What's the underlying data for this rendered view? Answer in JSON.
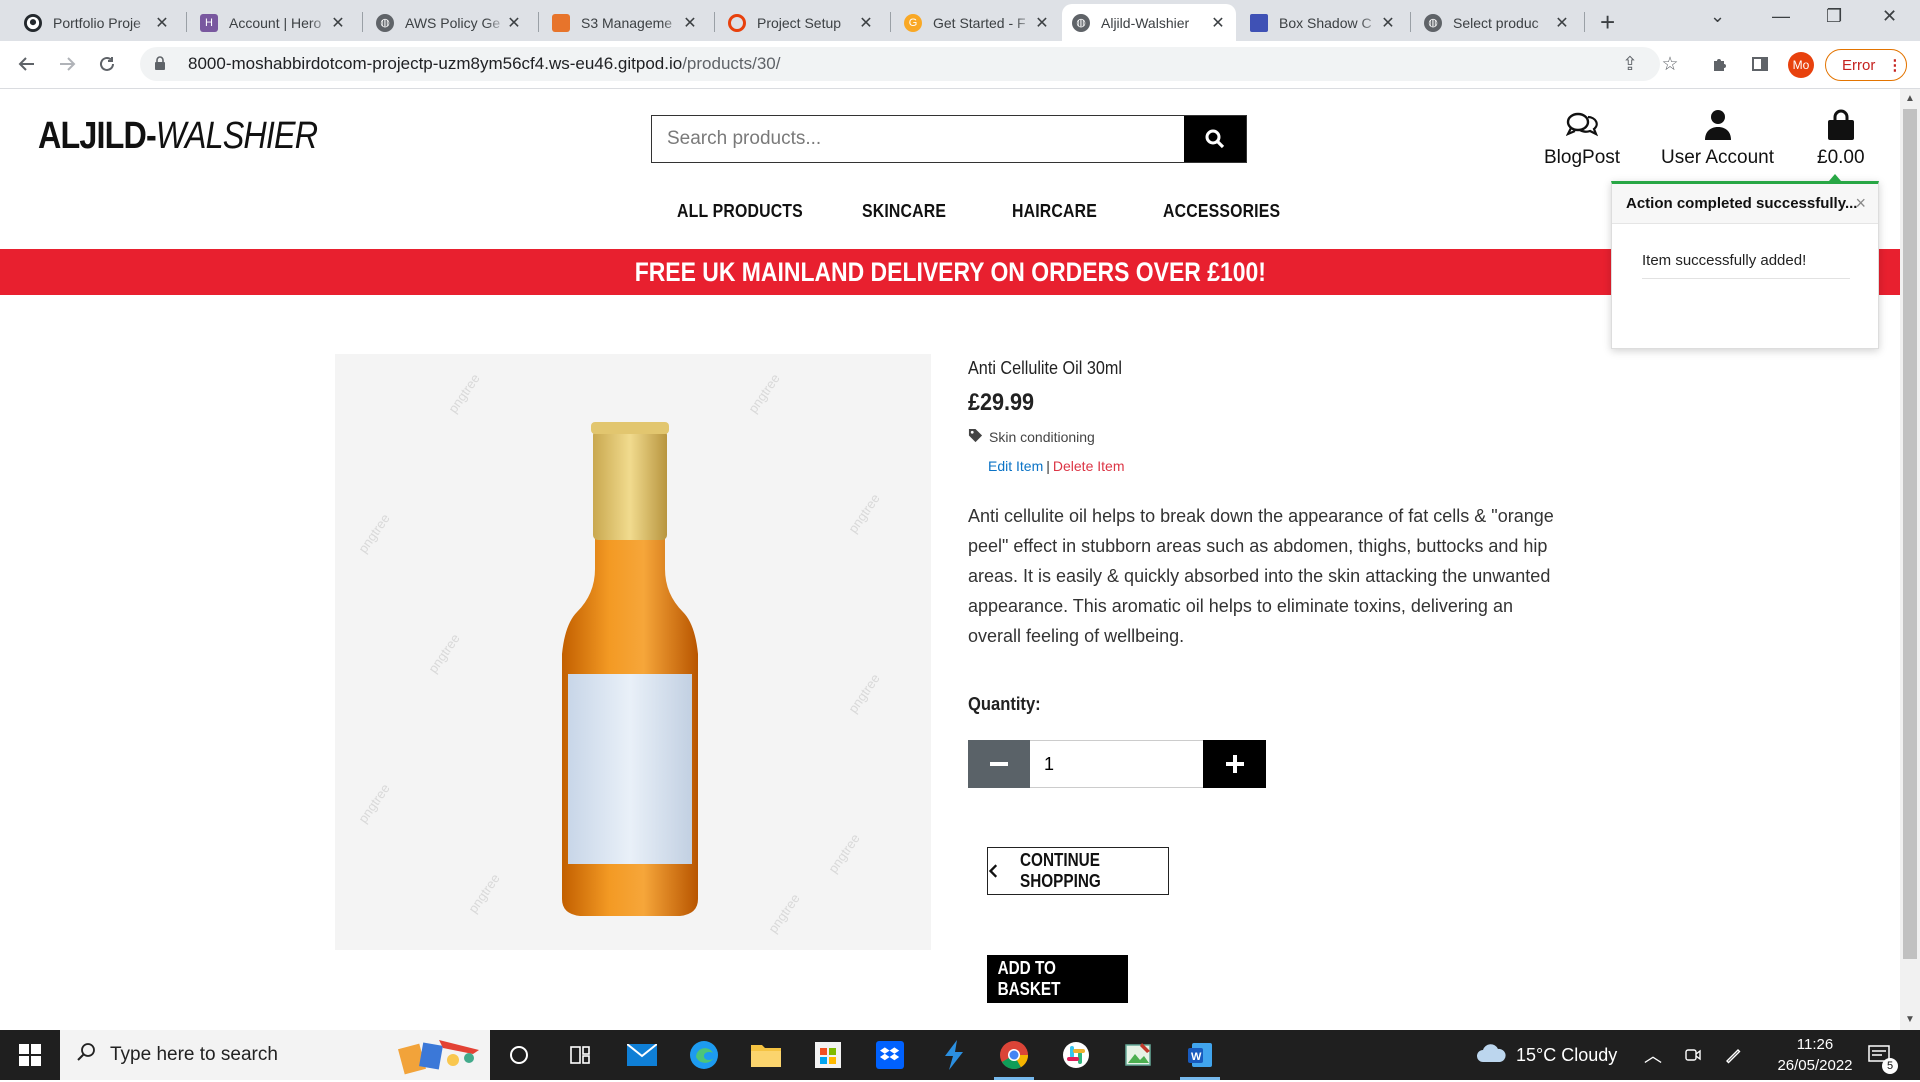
{
  "browser": {
    "tabs": [
      {
        "title": "Portfolio Proje",
        "icon": "github-icon"
      },
      {
        "title": "Account | Hero",
        "icon": "heroku-icon"
      },
      {
        "title": "AWS Policy Ge",
        "icon": "globe-icon"
      },
      {
        "title": "S3 Manageme",
        "icon": "aws-s3-icon"
      },
      {
        "title": "Project Setup",
        "icon": "opera-icon"
      },
      {
        "title": "Get Started - F",
        "icon": "get-started-icon"
      },
      {
        "title": "Aljild-Walshier",
        "icon": "globe-icon",
        "active": true
      },
      {
        "title": "Box Shadow C",
        "icon": "box-shadow-icon"
      },
      {
        "title": "Select produc",
        "icon": "globe-icon"
      }
    ],
    "url_host": "8000-moshabbirdotcom-projectp-uzm8ym56cf4.ws-eu46.gitpod.io",
    "url_path": "/products/30/",
    "profile_initials": "Mo",
    "error_label": "Error"
  },
  "site": {
    "logo_bold": "ALJILD-",
    "logo_italic": "WALSHIER",
    "search_placeholder": "Search products...",
    "header_links": {
      "blog": "BlogPost",
      "account": "User Account",
      "basket": "£0.00"
    },
    "nav": [
      "ALL PRODUCTS",
      "SKINCARE",
      "HAIRCARE",
      "ACCESSORIES"
    ],
    "banner": "FREE UK MAINLAND DELIVERY ON ORDERS OVER £100!"
  },
  "toast": {
    "title": "Action completed successfully...",
    "close": "×",
    "message": "Item successfully added!"
  },
  "product": {
    "name": "Anti Cellulite Oil 30ml",
    "price": "£29.99",
    "category": "Skin conditioning",
    "edit_label": "Edit Item",
    "admin_separator": "|",
    "delete_label": "Delete Item",
    "description": "Anti cellulite oil helps to break down the appearance of fat cells & \"orange peel\" effect in stubborn areas such as abdomen, thighs, buttocks and hip areas. It is easily & quickly absorbed into the skin attacking the unwanted appearance. This aromatic oil helps to eliminate toxins, delivering an overall feeling of wellbeing.",
    "quantity_label": "Quantity:",
    "quantity_value": "1",
    "continue_label": "CONTINUE SHOPPING",
    "add_label": "ADD TO BASKET"
  },
  "taskbar": {
    "search_placeholder": "Type here to search",
    "weather": "15°C  Cloudy",
    "time": "11:26",
    "date": "26/05/2022",
    "notification_count": "5"
  },
  "colors": {
    "banner_red": "#e8202f",
    "toast_green": "#28a745",
    "edit_link": "#0b73c6",
    "delete_link": "#dc3545"
  }
}
